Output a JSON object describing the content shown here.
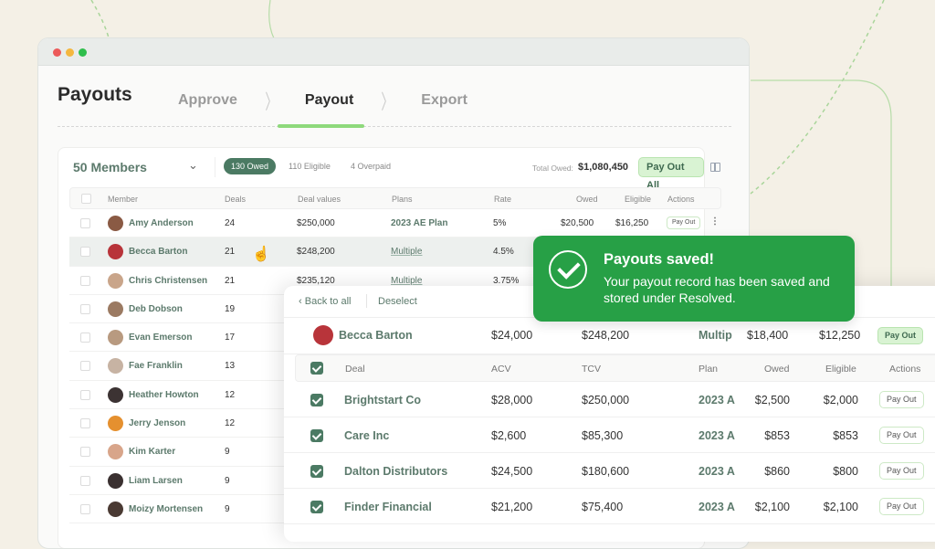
{
  "window": {
    "title": "Payouts"
  },
  "steps": [
    {
      "label": "Approve",
      "active": false
    },
    {
      "label": "Payout",
      "active": true
    },
    {
      "label": "Export",
      "active": false
    }
  ],
  "summary": {
    "members_label": "50 Members",
    "filters": [
      {
        "label": "130 Owed",
        "active": true
      },
      {
        "label": "110 Eligible",
        "active": false
      },
      {
        "label": "4 Overpaid",
        "active": false
      }
    ],
    "total_owed_label": "Total Owed:",
    "total_owed_value": "$1,080,450",
    "pay_out_all": "Pay Out All"
  },
  "members_table": {
    "headers": [
      "Member",
      "Deals",
      "Deal values",
      "Plans",
      "Rate",
      "Owed",
      "Eligible",
      "Actions"
    ],
    "rows": [
      {
        "name": "Amy Anderson",
        "deals": "24",
        "value": "$250,000",
        "plan": "2023 AE Plan",
        "rate": "5%",
        "owed": "$20,500",
        "eligible": "$16,250",
        "action": "Pay Out",
        "avatar": "#8a5a44"
      },
      {
        "name": "Becca Barton",
        "deals": "21",
        "value": "$248,200",
        "plan": "Multiple",
        "rate": "4.5%",
        "avatar": "#b8343a"
      },
      {
        "name": "Chris Christensen",
        "deals": "21",
        "value": "$235,120",
        "plan": "Multiple",
        "rate": "3.75%",
        "avatar": "#c9a58a"
      },
      {
        "name": "Deb Dobson",
        "deals": "19",
        "avatar": "#9b7a62"
      },
      {
        "name": "Evan Emerson",
        "deals": "17",
        "avatar": "#b89a80"
      },
      {
        "name": "Fae Franklin",
        "deals": "13",
        "avatar": "#c7b3a3"
      },
      {
        "name": "Heather Howton",
        "deals": "12",
        "avatar": "#3c3333"
      },
      {
        "name": "Jerry Jenson",
        "deals": "12",
        "avatar": "#e5902f"
      },
      {
        "name": "Kim Karter",
        "deals": "9",
        "avatar": "#d8a58a"
      },
      {
        "name": "Liam Larsen",
        "deals": "9",
        "avatar": "#3a3030"
      },
      {
        "name": "Moizy Mortensen",
        "deals": "9",
        "avatar": "#4a3a33"
      }
    ]
  },
  "detail": {
    "back_label": "Back to all",
    "deselect_label": "Deselect",
    "member": {
      "name": "Becca Barton",
      "acv": "$24,000",
      "tcv": "$248,200",
      "plan": "Multip",
      "owed": "$18,400",
      "eligible": "$12,250",
      "action": "Pay Out"
    },
    "headers": [
      "Deal",
      "ACV",
      "TCV",
      "Plan",
      "Owed",
      "Eligible",
      "Actions"
    ],
    "deals": [
      {
        "name": "Brightstart Co",
        "acv": "$28,000",
        "tcv": "$250,000",
        "plan": "2023 A",
        "owed": "$2,500",
        "eligible": "$2,000",
        "action": "Pay Out"
      },
      {
        "name": "Care Inc",
        "acv": "$2,600",
        "tcv": "$85,300",
        "plan": "2023 A",
        "owed": "$853",
        "eligible": "$853",
        "action": "Pay Out"
      },
      {
        "name": "Dalton Distributors",
        "acv": "$24,500",
        "tcv": "$180,600",
        "plan": "2023 A",
        "owed": "$860",
        "eligible": "$800",
        "action": "Pay Out"
      },
      {
        "name": "Finder Financial",
        "acv": "$21,200",
        "tcv": "$75,400",
        "plan": "2023 A",
        "owed": "$2,100",
        "eligible": "$2,100",
        "action": "Pay Out"
      }
    ]
  },
  "toast": {
    "title": "Payouts saved!",
    "message": "Your payout record has been saved and stored under Resolved."
  },
  "colors": {
    "accent": "#27a046",
    "brand_dark": "#4b7a63",
    "background": "#f4f0e6"
  }
}
